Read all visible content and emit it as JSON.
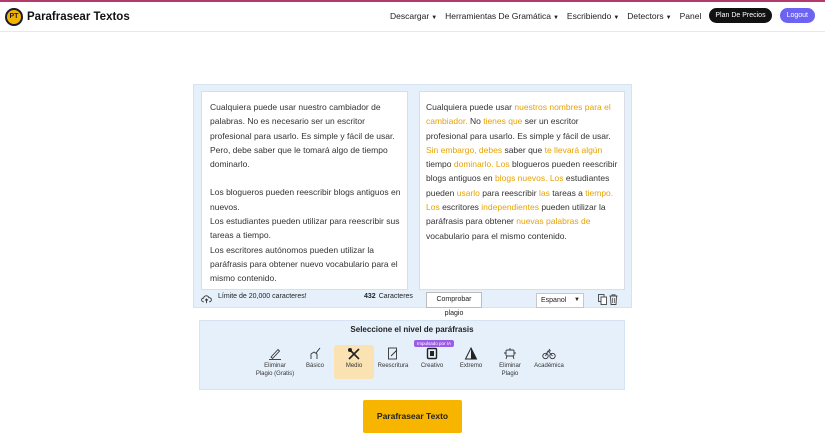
{
  "header": {
    "logo_text": "PT",
    "brand": "Parafrasear Textos",
    "nav": [
      {
        "label": "Descargar",
        "dropdown": true
      },
      {
        "label": "Herramientas De Gramática",
        "dropdown": true
      },
      {
        "label": "Escribiendo",
        "dropdown": true
      },
      {
        "label": "Detectors",
        "dropdown": true
      },
      {
        "label": "Panel",
        "dropdown": false
      }
    ],
    "plan_label": "Plan De Precios",
    "logout_label": "Logout",
    "logout_color": "#6c63f2"
  },
  "input": {
    "paragraphs": [
      "Cualquiera puede usar nuestro cambiador de palabras. No es necesario ser un escritor profesional para usarlo. Es simple y fácil de usar. Pero, debe saber que le tomará algo de tiempo dominarlo.",
      "",
      "Los blogueros pueden reescribir blogs antiguos en nuevos.",
      "Los estudiantes pueden utilizar para reescribir sus tareas a tiempo.",
      "Los escritores autónomos pueden utilizar la paráfrasis para obtener nuevo vocabulario para el mismo contenido."
    ],
    "limit_text": "Límite de 20,000 caracteres!",
    "char_count": "432",
    "char_label": "Caracteres"
  },
  "output": {
    "highlight_color": "#e8a200",
    "segments": [
      {
        "t": "Cualquiera puede usar ",
        "h": false
      },
      {
        "t": "nuestros nombres para el cambiador.",
        "h": true
      },
      {
        "t": " No ",
        "h": false
      },
      {
        "t": "tienes que",
        "h": true
      },
      {
        "t": " ser un escritor profesional para usarlo. Es simple y fácil de usar. ",
        "h": false
      },
      {
        "t": "Sin embargo, debes",
        "h": true
      },
      {
        "t": " saber que ",
        "h": false
      },
      {
        "t": "te llevará algún",
        "h": true
      },
      {
        "t": " tiempo ",
        "h": false
      },
      {
        "t": "dominarlo. Los",
        "h": true
      },
      {
        "t": " blogueros pueden reescribir blogs antiguos en ",
        "h": false
      },
      {
        "t": "blogs nuevos. Los",
        "h": true
      },
      {
        "t": " estudiantes pueden ",
        "h": false
      },
      {
        "t": "usarlo",
        "h": true
      },
      {
        "t": " para reescribir ",
        "h": false
      },
      {
        "t": "las",
        "h": true
      },
      {
        "t": " tareas a ",
        "h": false
      },
      {
        "t": "tiempo. Los",
        "h": true
      },
      {
        "t": " escritores ",
        "h": false
      },
      {
        "t": "independientes",
        "h": true
      },
      {
        "t": " pueden utilizar la paráfrasis para obtener ",
        "h": false
      },
      {
        "t": "nuevas palabras de",
        "h": true
      },
      {
        "t": " vocabulario para el mismo contenido.",
        "h": false
      }
    ],
    "check_label": "Comprobar plagio",
    "language": "Espanol"
  },
  "levels": {
    "title": "Seleccione el nivel de paráfrasis",
    "ia_badge": "Impulsado por IA",
    "items": [
      {
        "label": "Eliminar Plagio (Gratis)",
        "icon": "pen-icon"
      },
      {
        "label": "Básico",
        "icon": "hand-pen-icon"
      },
      {
        "label": "Medio",
        "icon": "crossed-tools-icon",
        "active": true
      },
      {
        "label": "Reescritura",
        "icon": "document-pen-icon"
      },
      {
        "label": "Creativo",
        "icon": "creative-chip-icon"
      },
      {
        "label": "Extremo",
        "icon": "pyramid-icon"
      },
      {
        "label": "Eliminar Plagio",
        "icon": "robot-icon"
      },
      {
        "label": "Académica",
        "icon": "bicycle-icon"
      }
    ]
  },
  "primary_button": "Parafrasear Texto",
  "accent_color": "#f7b500"
}
